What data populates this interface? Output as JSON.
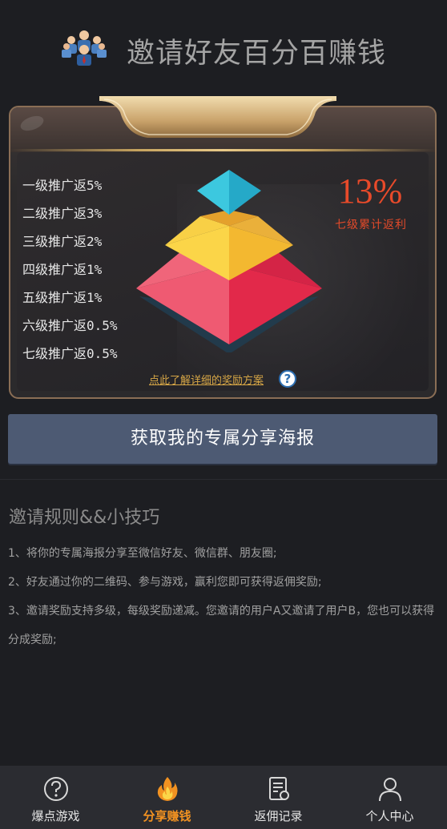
{
  "header": {
    "title": "邀请好友百分百赚钱",
    "logo_icon": "team-people-icon"
  },
  "levels": [
    "一级推广返5%",
    "二级推广返3%",
    "三级推广返2%",
    "四级推广返1%",
    "五级推广返1%",
    "六级推广返0.5%",
    "七级推广返0.5%"
  ],
  "total": {
    "percent": "13%",
    "label": "七级累计返利"
  },
  "detail_link": "点此了解详细的奖励方案",
  "poster_button": "获取我的专属分享海报",
  "rules": {
    "title": "邀请规则&&小技巧",
    "items": [
      "1、将你的专属海报分享至微信好友、微信群、朋友圈;",
      "2、好友通过你的二维码、参与游戏，赢利您即可获得返佣奖励;",
      "3、邀请奖励支持多级，每级奖励递减。您邀请的用户A又邀请了用户B，您也可以获得分成奖励;"
    ]
  },
  "nav": [
    {
      "label": "爆点游戏",
      "icon": "question-circle-icon",
      "active": false
    },
    {
      "label": "分享赚钱",
      "icon": "flame-icon",
      "active": true
    },
    {
      "label": "返佣记录",
      "icon": "document-record-icon",
      "active": false
    },
    {
      "label": "个人中心",
      "icon": "user-icon",
      "active": false
    }
  ],
  "colors": {
    "accent": "#f29221",
    "percent": "#e84a2a",
    "button": "#4d5a73",
    "background": "#1d1e22"
  }
}
